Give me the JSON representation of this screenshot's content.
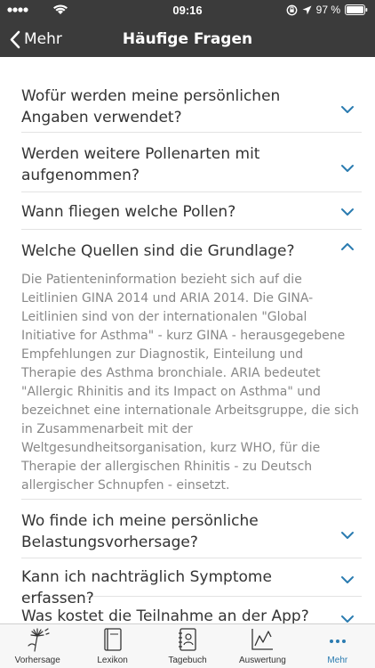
{
  "status": {
    "time": "09:16",
    "battery": "97 %"
  },
  "nav": {
    "back_label": "Mehr",
    "title": "Häufige Fragen"
  },
  "faq": [
    {
      "question": "Wofür werden meine persönlichen Angaben verwendet?",
      "expanded": false
    },
    {
      "question": "Werden weitere Pollenarten mit aufgenommen?",
      "expanded": false
    },
    {
      "question": "Wann fliegen welche Pollen?",
      "expanded": false
    },
    {
      "question": "Welche Quellen sind die Grundlage?",
      "expanded": true,
      "answer": "Die Patienteninformation bezieht sich auf die Leitlinien GINA 2014 und ARIA 2014. Die GINA-Leitlinien sind von der internationalen \"Global Initiative for Asthma\" - kurz GINA - herausgegebene Empfehlungen zur Diagnostik, Einteilung und Therapie des Asthma bronchiale. ARIA bedeutet \"Allergic Rhinitis and its Impact on Asthma\" und bezeichnet eine internationale Arbeitsgruppe, die sich in Zusammenarbeit mit der Weltgesundheitsorganisation, kurz WHO, für die Therapie der allergischen Rhinitis - zu Deutsch allergischer Schnupfen - einsetzt."
    },
    {
      "question": "Wo finde ich meine persönliche Belastungsvorhersage?",
      "expanded": false
    },
    {
      "question": "Kann ich nachträglich Symptome erfassen?",
      "expanded": false
    },
    {
      "question": "Was kostet die Teilnahme an der App?",
      "expanded": false
    }
  ],
  "tabs": [
    {
      "label": "Vorhersage",
      "icon": "dandelion-icon"
    },
    {
      "label": "Lexikon",
      "icon": "book-icon"
    },
    {
      "label": "Tagebuch",
      "icon": "diary-icon"
    },
    {
      "label": "Auswertung",
      "icon": "chart-icon"
    },
    {
      "label": "Mehr",
      "icon": "more-icon",
      "active": true
    }
  ],
  "colors": {
    "bar": "#3b3b3b",
    "accent": "#2a7bb0",
    "question_text": "#333333",
    "answer_text": "#888888"
  }
}
